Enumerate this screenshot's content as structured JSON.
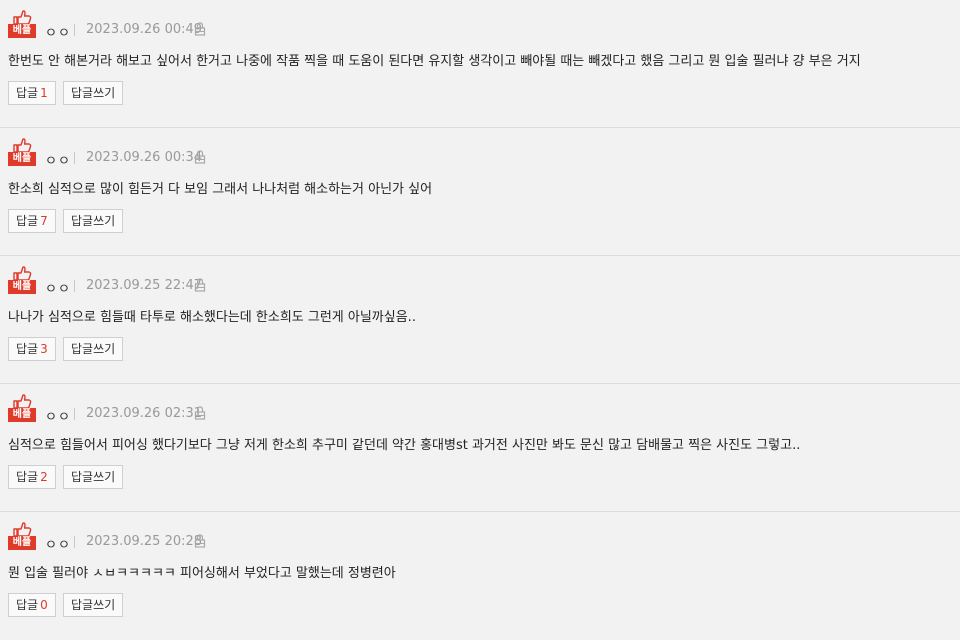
{
  "badge_label": "베플",
  "reply_label": "답글",
  "write_reply_label": "답글쓰기",
  "accent_color": "#e03a2a",
  "icons": {
    "best": "thumbs-up-icon",
    "lock": "lock-icon"
  },
  "comments": [
    {
      "author": "ㅇㅇ",
      "date": "2023.09.26 00:49",
      "text": "한번도 안 해본거라 해보고 싶어서 한거고 나중에 작품 찍을 때 도움이 된다면 유지할 생각이고 빼야될 때는 빼겠다고 했음 그리고 뭔 입술 필러냐 걍 부은 거지",
      "reply_count": "1"
    },
    {
      "author": "ㅇㅇ",
      "date": "2023.09.26 00:34",
      "text": "한소희 심적으로 많이 힘든거 다 보임 그래서 나나처럼 해소하는거 아닌가 싶어",
      "reply_count": "7"
    },
    {
      "author": "ㅇㅇ",
      "date": "2023.09.25 22:47",
      "text": "나나가 심적으로 힘들때 타투로 해소했다는데 한소희도 그런게 아닐까싶음..",
      "reply_count": "3"
    },
    {
      "author": "ㅇㅇ",
      "date": "2023.09.26 02:31",
      "text": "심적으로 힘들어서 피어싱 했다기보다 그냥 저게 한소희 추구미 같던데 약간 홍대병st 과거전 사진만 봐도 문신 많고 담배물고 찍은 사진도 그렇고..",
      "reply_count": "2"
    },
    {
      "author": "ㅇㅇ",
      "date": "2023.09.25 20:28",
      "text": "뭔 입술 필러야 ㅅㅂㅋㅋㅋㅋㅋ 피어싱해서 부었다고 말했는데 정병련아",
      "reply_count": "0"
    }
  ]
}
